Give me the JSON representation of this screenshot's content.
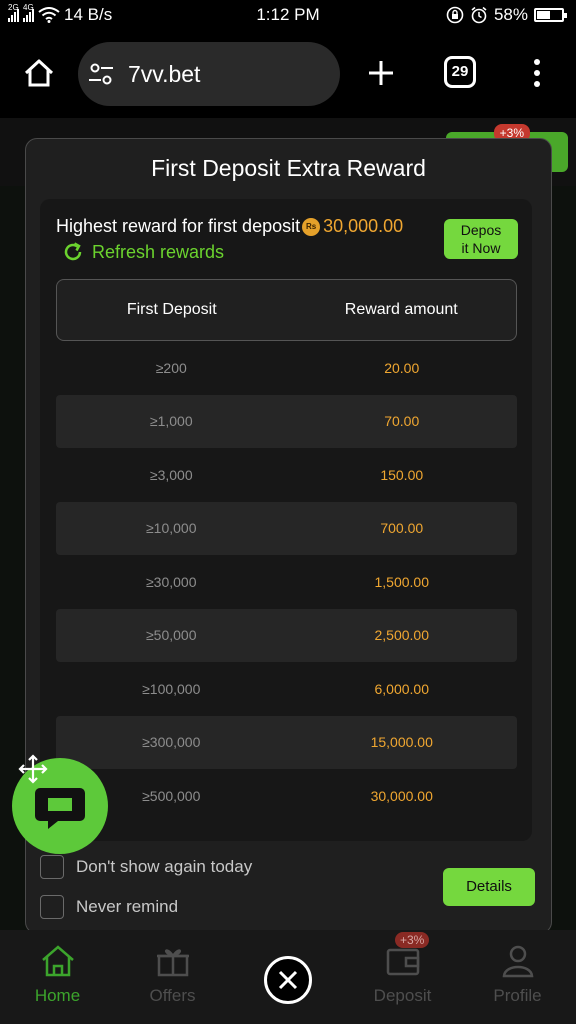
{
  "status_bar": {
    "signal_1_label": "2G",
    "signal_2_label": "4G",
    "speed": "14 B/s",
    "time": "1:12 PM",
    "battery": "58%"
  },
  "browser": {
    "url": "7vv.bet",
    "tab_count": "29"
  },
  "modal": {
    "title": "First Deposit Extra Reward",
    "highlight_prefix": "Highest reward for first deposit",
    "currency_symbol": "Rs",
    "highlight_amount": "30,000.00",
    "refresh_label": "Refresh rewards",
    "deposit_button": "Depos\nit Now",
    "table": {
      "headers": [
        "First Deposit",
        "Reward amount"
      ],
      "rows": [
        {
          "deposit": "≥200",
          "reward": "20.00"
        },
        {
          "deposit": "≥1,000",
          "reward": "70.00"
        },
        {
          "deposit": "≥3,000",
          "reward": "150.00"
        },
        {
          "deposit": "≥10,000",
          "reward": "700.00"
        },
        {
          "deposit": "≥30,000",
          "reward": "1,500.00"
        },
        {
          "deposit": "≥50,000",
          "reward": "2,500.00"
        },
        {
          "deposit": "≥100,000",
          "reward": "6,000.00"
        },
        {
          "deposit": "≥300,000",
          "reward": "15,000.00"
        },
        {
          "deposit": "≥500,000",
          "reward": "30,000.00"
        }
      ]
    },
    "dont_show_label": "Don't show again today",
    "never_remind_label": "Never remind",
    "details_button": "Details"
  },
  "background": {
    "header_tag": "+3%"
  },
  "bottom_nav": {
    "items": [
      {
        "label": "Home",
        "icon": "home-icon"
      },
      {
        "label": "Offers",
        "icon": "gift-icon"
      },
      {
        "label": "",
        "icon": "close-icon"
      },
      {
        "label": "Deposit",
        "icon": "wallet-icon"
      },
      {
        "label": "Profile",
        "icon": "profile-icon"
      }
    ],
    "deposit_tag": "+3%"
  },
  "colors": {
    "accent_green": "#75d83e",
    "amount_orange": "#f0a731",
    "modal_bg": "#1f1f1f"
  }
}
